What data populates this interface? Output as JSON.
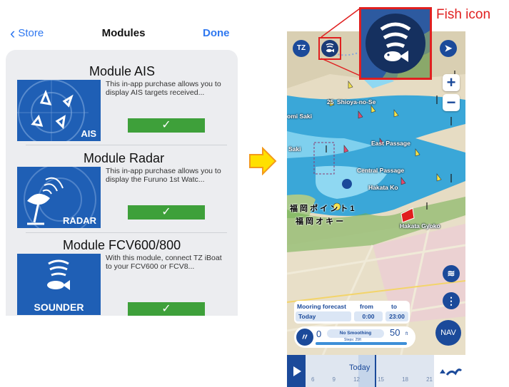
{
  "store": {
    "back_label": "Store",
    "title": "Modules",
    "done_label": "Done",
    "modules": [
      {
        "name": "Module AIS",
        "description": "This in-app purchase allows you to display AIS targets received...",
        "thumb_label": "AIS",
        "purchased": true
      },
      {
        "name": "Module Radar",
        "description": "This in-app purchase allows you to display the Furuno 1st Watc...",
        "thumb_label": "RADAR",
        "purchased": true
      },
      {
        "name": "Module FCV600/800",
        "description": "With this module, connect TZ iBoat to your FCV600 or FCV8...",
        "thumb_label": "SOUNDER",
        "purchased": true
      }
    ],
    "check_glyph": "✓"
  },
  "map": {
    "tz_label": "TZ",
    "zoom_in": "+",
    "zoom_out": "−",
    "place_labels": {
      "shioya": "Shioya-no-Se",
      "east_passage": "East Passage",
      "central_passage": "Central Passage",
      "hakata_ko": "Hakata Ko",
      "saki": "Saki",
      "hakata_gyoko": "Hakata Gyoko",
      "depth_25": "25",
      "tomi": "omi Saki"
    },
    "jp_label_1": "福 岡 ポ イ ン ト 1",
    "jp_label_2": "福 岡 オ キ ー",
    "forecast": {
      "title": "Mooring forecast",
      "from_label": "from",
      "to_label": "to",
      "day": "Today",
      "from_time": "0:00",
      "to_time": "23:00"
    },
    "smoothing": {
      "min": "0",
      "label": "No Smoothing",
      "steps": "Steps: 25ft",
      "max": "50",
      "unit": "ft"
    },
    "nav_label": "NAV",
    "timeline": {
      "day": "Today",
      "hours": [
        "6",
        "9",
        "12",
        "15",
        "18",
        "21"
      ]
    }
  },
  "callout": {
    "label": "Fish icon"
  },
  "colors": {
    "accent": "#2f78f0",
    "brand_blue": "#1b4a9a",
    "purchased_green": "#3ea03a",
    "callout_red": "#e02020",
    "sea_blue": "#3aa7d8",
    "arrow_yellow": "#ffe000",
    "arrow_orange": "#f39a1c"
  }
}
